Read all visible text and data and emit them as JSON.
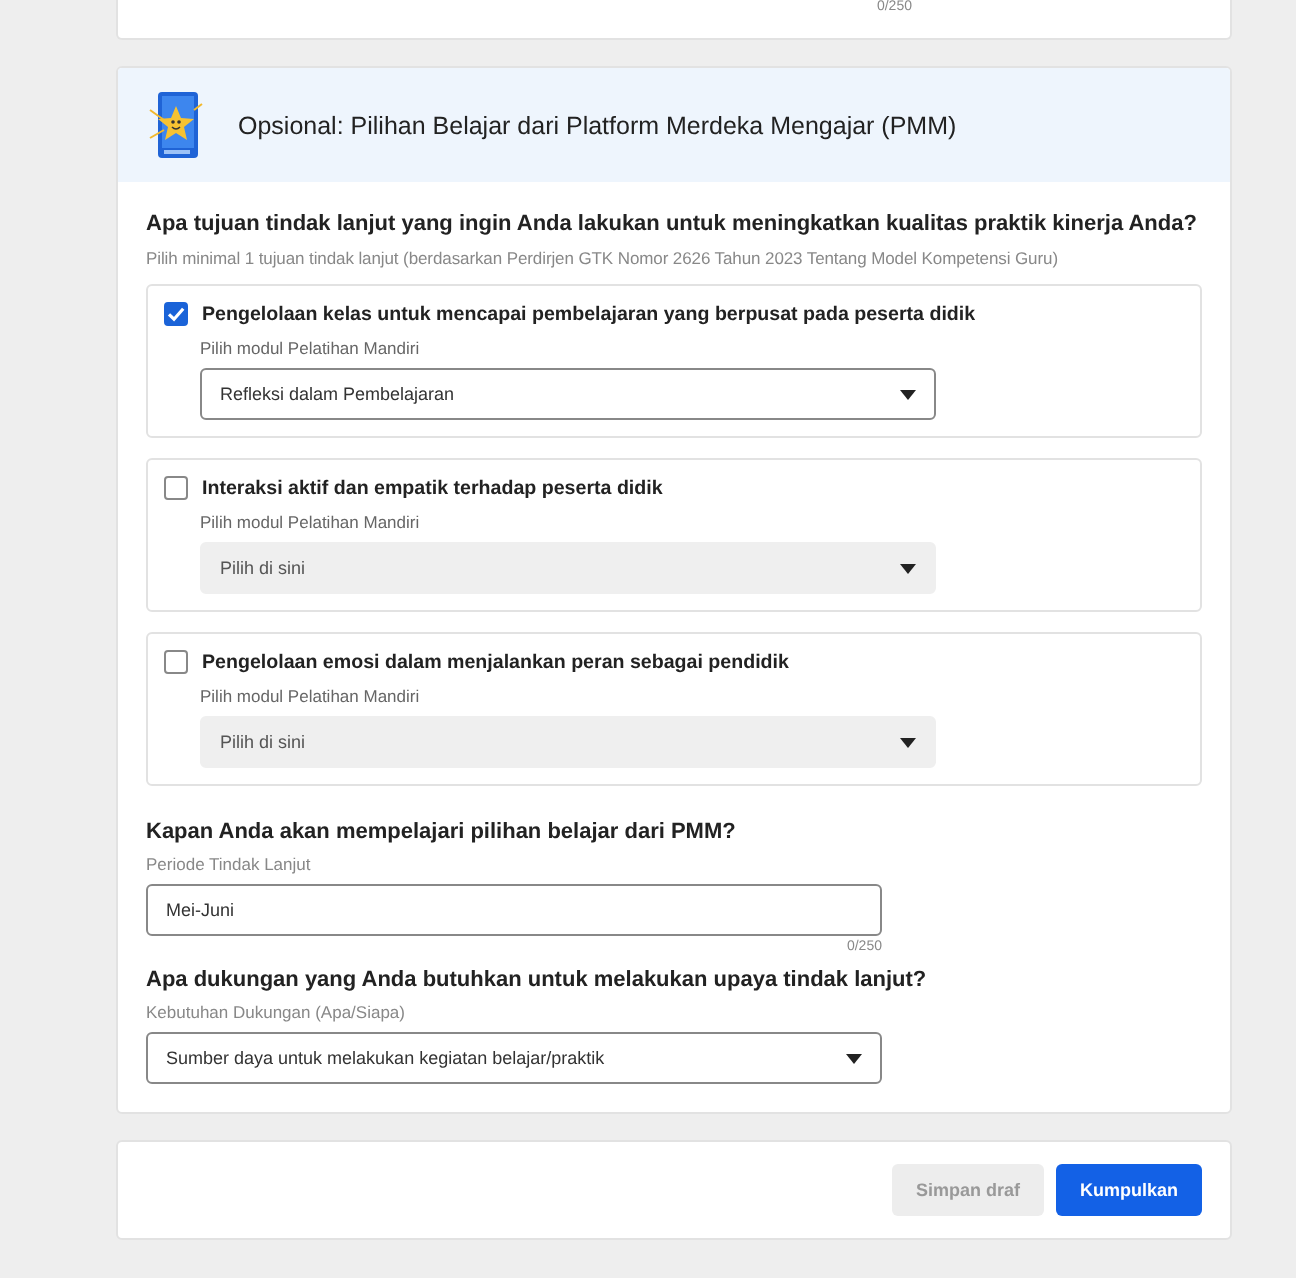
{
  "top_card": {
    "counter": "0/250"
  },
  "section": {
    "title": "Opsional: Pilihan Belajar dari Platform Merdeka Mengajar (PMM)",
    "question": "Apa tujuan tindak lanjut yang ingin Anda lakukan untuk meningkatkan kualitas praktik kinerja Anda?",
    "hint": "Pilih minimal 1 tujuan tindak lanjut (berdasarkan Perdirjen GTK Nomor 2626 Tahun 2023 Tentang Model Kompetensi Guru)",
    "options": [
      {
        "label": "Pengelolaan kelas untuk mencapai pembelajaran yang berpusat pada peserta didik",
        "checked": true,
        "select_label": "Pilih modul Pelatihan Mandiri",
        "select": {
          "value": "Refleksi dalam Pembelajaran",
          "disabled": false
        }
      },
      {
        "label": "Interaksi aktif dan empatik terhadap peserta didik",
        "checked": false,
        "select_label": "Pilih modul Pelatihan Mandiri",
        "select": {
          "placeholder": "Pilih di sini",
          "disabled": true
        }
      },
      {
        "label": "Pengelolaan emosi dalam menjalankan peran sebagai pendidik",
        "checked": false,
        "select_label": "Pilih modul Pelatihan Mandiri",
        "select": {
          "placeholder": "Pilih di sini",
          "disabled": true
        }
      }
    ],
    "period": {
      "question": "Kapan Anda akan mempelajari pilihan belajar dari PMM?",
      "label": "Periode Tindak Lanjut",
      "value": "Mei-Juni",
      "counter": "0/250"
    },
    "support": {
      "question": "Apa dukungan yang Anda butuhkan untuk melakukan upaya tindak lanjut?",
      "label": "Kebutuhan Dukungan (Apa/Siapa)",
      "value": "Sumber daya untuk melakukan kegiatan belajar/praktik"
    }
  },
  "footer": {
    "buttons": [
      {
        "label": "Simpan draf",
        "kind": "secondary"
      },
      {
        "label": "Kumpulkan",
        "kind": "primary"
      }
    ]
  }
}
